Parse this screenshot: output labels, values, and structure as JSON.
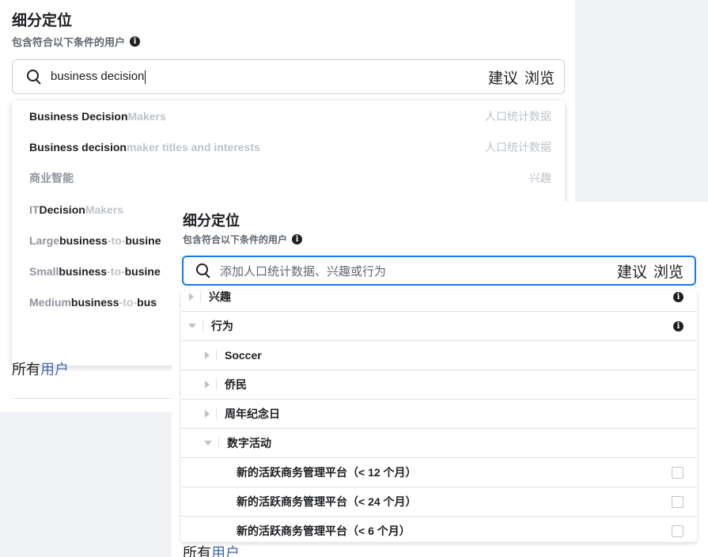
{
  "back": {
    "title": "细分定位",
    "subtitle": "包含符合以下条件的用户",
    "search_value": "business decision",
    "suggest_link": "建议",
    "browse_link": "浏览",
    "suggestions": [
      {
        "match": "Business Decision",
        "rest": " Makers",
        "category": "人口统计数据"
      },
      {
        "match": "Business decision",
        "rest": " maker titles and interests",
        "category": "人口统计数据"
      },
      {
        "plain": "商业智能",
        "category": "兴趣"
      },
      {
        "prefix": "IT ",
        "match": "Decision",
        "rest": " Makers"
      },
      {
        "prefix": "Large ",
        "match": "business",
        "rest": "-to-",
        "match2": "busine"
      },
      {
        "prefix": "Small ",
        "match": "business",
        "rest": "-to-",
        "match2": "busine"
      },
      {
        "prefix": "Medium ",
        "match": "business",
        "rest": "-to-",
        "match2": "bus"
      }
    ],
    "tail_text": "所有",
    "tail_link": "用户"
  },
  "front": {
    "title": "细分定位",
    "subtitle": "包含符合以下条件的用户",
    "search_placeholder": "添加人口统计数据、兴趣或行为",
    "suggest_link": "建议",
    "browse_link": "浏览",
    "tree": [
      {
        "label": "兴趣",
        "expanded": false,
        "level": 0
      },
      {
        "label": "行为",
        "expanded": true,
        "level": 0
      },
      {
        "label": "Soccer",
        "expanded": false,
        "level": 1
      },
      {
        "label": "侨民",
        "expanded": false,
        "level": 1
      },
      {
        "label": "周年纪念日",
        "expanded": false,
        "level": 1
      },
      {
        "label": "数字活动",
        "expanded": true,
        "level": 1
      },
      {
        "label": "新的活跃商务管理平台（< 12 个月）",
        "level": 2,
        "checked": false
      },
      {
        "label": "新的活跃商务管理平台（< 24 个月）",
        "level": 2,
        "checked": false
      },
      {
        "label": "新的活跃商务管理平台（< 6 个月）",
        "level": 2,
        "checked": false
      }
    ],
    "tail_text": "所有",
    "tail_link": "用户"
  }
}
